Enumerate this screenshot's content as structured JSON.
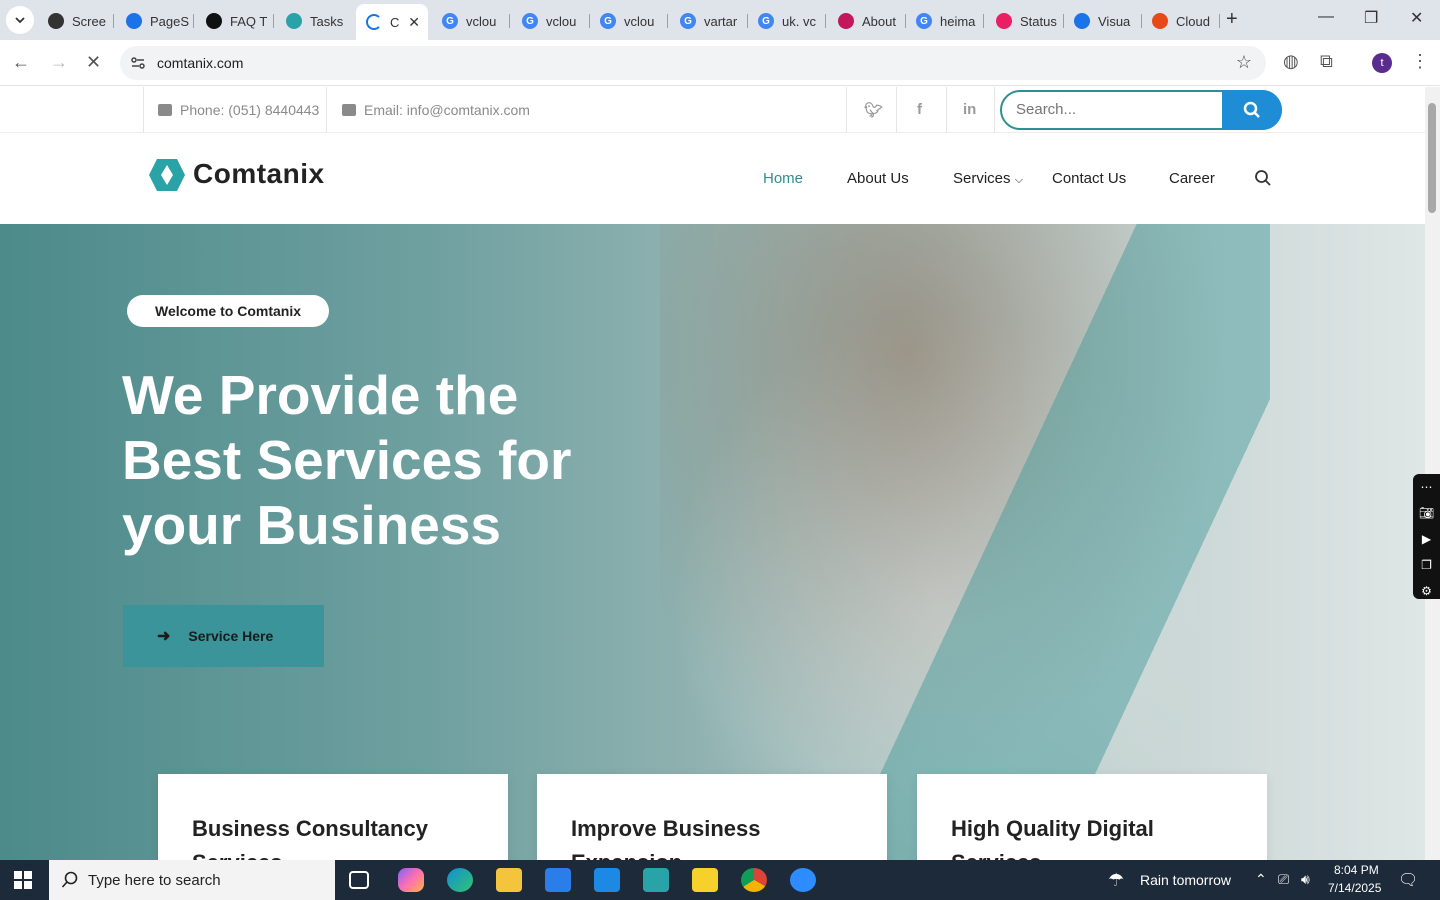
{
  "browser": {
    "tabs": [
      {
        "title": "Scree",
        "color": "#333333"
      },
      {
        "title": "PageS",
        "color": "#1a73e8"
      },
      {
        "title": "FAQ T",
        "color": "#111111"
      },
      {
        "title": "Tasks",
        "color": "#2aa3a8"
      },
      {
        "title": "C",
        "color": "#1a73e8",
        "active": true
      },
      {
        "title": "vclou",
        "color": "#4285f4"
      },
      {
        "title": "vclou",
        "color": "#4285f4"
      },
      {
        "title": "vclou",
        "color": "#4285f4"
      },
      {
        "title": "vartar",
        "color": "#4285f4"
      },
      {
        "title": "uk. vc",
        "color": "#4285f4"
      },
      {
        "title": "About",
        "color": "#c2185b"
      },
      {
        "title": "heima",
        "color": "#4285f4"
      },
      {
        "title": "Status",
        "color": "#e91e63"
      },
      {
        "title": "Visua",
        "color": "#1a73e8"
      },
      {
        "title": "Cloud",
        "color": "#e64a19"
      }
    ],
    "url": "comtanix.com",
    "profile_initial": "t"
  },
  "topbar": {
    "phone": "Phone: (051) 8440443",
    "email": "Email: info@comtanix.com",
    "search_placeholder": "Search..."
  },
  "brand": {
    "name": "Comtanix",
    "accent": "#2e8f93"
  },
  "menu": {
    "home": "Home",
    "about": "About Us",
    "services": "Services",
    "contact": "Contact Us",
    "career": "Career"
  },
  "hero": {
    "badge": "Welcome to Comtanix",
    "title": "We Provide the Best Services for your Business",
    "cta": "Service Here"
  },
  "cards": [
    {
      "title": "Business Consultancy Services"
    },
    {
      "title": "Improve Business Expansion"
    },
    {
      "title": "High Quality Digital Services"
    }
  ],
  "taskbar": {
    "search_placeholder": "Type here to search",
    "weather": "Rain tomorrow",
    "time": "8:04 PM",
    "date": "7/14/2025"
  }
}
